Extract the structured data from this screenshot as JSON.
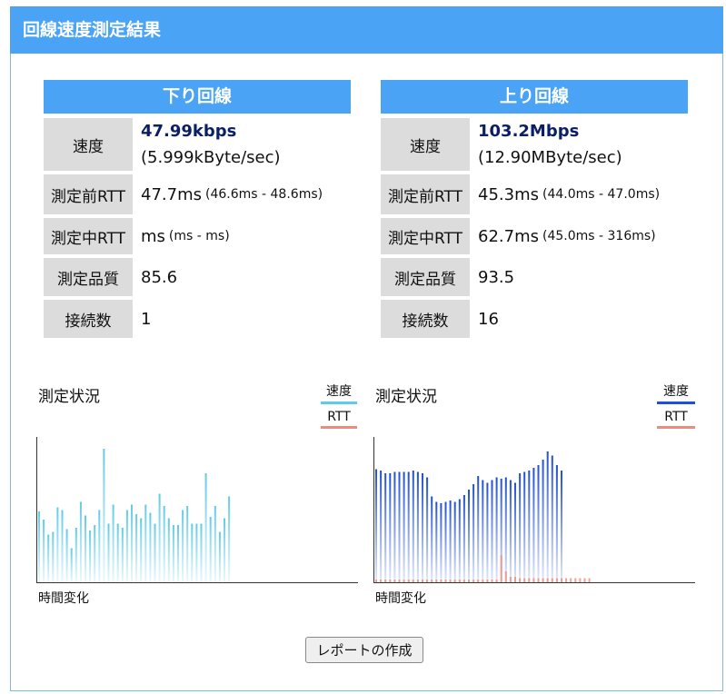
{
  "header": {
    "title": "回線速度測定結果"
  },
  "download": {
    "title": "下り回線",
    "labels": {
      "speed": "速度",
      "rtt_before": "測定前RTT",
      "rtt_during": "測定中RTT",
      "quality": "測定品質",
      "connections": "接続数"
    },
    "speed_main": "47.99kbps",
    "speed_sub": "(5.999kByte/sec)",
    "rtt_before_main": "47.7ms",
    "rtt_before_range": "(46.6ms - 48.6ms)",
    "rtt_during_main": "ms",
    "rtt_during_range": "(ms - ms)",
    "quality": "85.6",
    "connections": "1"
  },
  "upload": {
    "title": "上り回線",
    "labels": {
      "speed": "速度",
      "rtt_before": "測定前RTT",
      "rtt_during": "測定中RTT",
      "quality": "測定品質",
      "connections": "接続数"
    },
    "speed_main": "103.2Mbps",
    "speed_sub": "(12.90MByte/sec)",
    "rtt_before_main": "45.3ms",
    "rtt_before_range": "(44.0ms - 47.0ms)",
    "rtt_during_main": "62.7ms",
    "rtt_during_range": "(45.0ms - 316ms)",
    "quality": "93.5",
    "connections": "16"
  },
  "charts": {
    "download": {
      "title": "測定状況",
      "legend_speed": "速度",
      "legend_rtt": "RTT",
      "xlabel": "時間変化"
    },
    "upload": {
      "title": "測定状況",
      "legend_speed": "速度",
      "legend_rtt": "RTT",
      "xlabel": "時間変化"
    }
  },
  "report_button": "レポートの作成",
  "colors": {
    "accent": "#4aa3f5",
    "download_speed": "#5fcbe8",
    "upload_speed": "#1f4fd6",
    "rtt": "#f08a7a"
  },
  "chart_data": [
    {
      "type": "bar",
      "title": "測定状況",
      "xlabel": "時間変化",
      "ylabel": "",
      "series": [
        {
          "name": "速度",
          "values": [
            52,
            46,
            35,
            37,
            55,
            53,
            39,
            25,
            40,
            59,
            49,
            38,
            42,
            53,
            98,
            43,
            57,
            43,
            40,
            53,
            57,
            50,
            47,
            57,
            51,
            43,
            65,
            56,
            47,
            42,
            42,
            53,
            56,
            43,
            43,
            43,
            80,
            48,
            56,
            37,
            47,
            63
          ]
        }
      ]
    },
    {
      "type": "bar",
      "title": "測定状況",
      "xlabel": "時間変化",
      "ylabel": "",
      "series": [
        {
          "name": "速度",
          "values": [
            83,
            82,
            80,
            80,
            81,
            81,
            81,
            81,
            82,
            81,
            80,
            77,
            63,
            59,
            58,
            59,
            60,
            59,
            61,
            64,
            68,
            72,
            78,
            75,
            73,
            75,
            77,
            76,
            77,
            75,
            73,
            80,
            81,
            82,
            84,
            86,
            90,
            96,
            93,
            86,
            82
          ]
        },
        {
          "name": "RTT",
          "values": [
            2,
            2,
            2,
            2,
            2,
            2,
            2,
            2,
            2,
            2,
            2,
            2,
            2,
            2,
            2,
            2,
            2,
            2,
            2,
            2,
            2,
            2,
            2,
            2,
            2,
            2,
            2,
            20,
            8,
            4,
            4,
            3,
            3,
            3,
            3,
            3,
            3,
            3,
            3,
            3,
            3,
            3,
            3,
            3,
            3,
            3,
            3
          ]
        }
      ]
    }
  ]
}
